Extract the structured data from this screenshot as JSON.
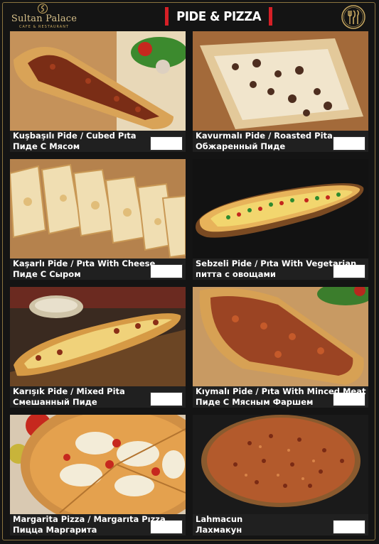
{
  "brand": {
    "name": "Sultan Palace",
    "tagline": "CAFE & RESTAURANT"
  },
  "header": {
    "title": "PIDE & PIZZA"
  },
  "icons": {
    "logo": "sultan-palace-logo",
    "cutlery": "cutlery-icon"
  },
  "colors": {
    "accent_red": "#d61f26",
    "gold": "#c9a961",
    "background": "#141414",
    "card": "#202020"
  },
  "items": [
    {
      "line1": "Kuşbaşılı Pide / Cubed Pıta",
      "line2": "Пиде С Мясом"
    },
    {
      "line1": "Kavurmalı Pide / Roasted Pita",
      "line2": "Обжаренный Пиде"
    },
    {
      "line1": "Kaşarlı Pide / Pıta With Cheese",
      "line2": "Пиде С Сыром"
    },
    {
      "line1": "Sebzeli Pide / Pıta With Vegetarian",
      "line2": "питта с овощами"
    },
    {
      "line1": "Karışık Pide / Mixed Pita",
      "line2": "Смешанный Пиде"
    },
    {
      "line1": "Kıymalı Pide / Pıta With Minced Meat",
      "line2": "Пиде С Мясным Фаршем"
    },
    {
      "line1": "Margarita Pizza / Margarıta Pızza",
      "line2": "Пицца Маргарита"
    },
    {
      "line1": "Lahmacun",
      "line2": "Лахмакун"
    }
  ]
}
